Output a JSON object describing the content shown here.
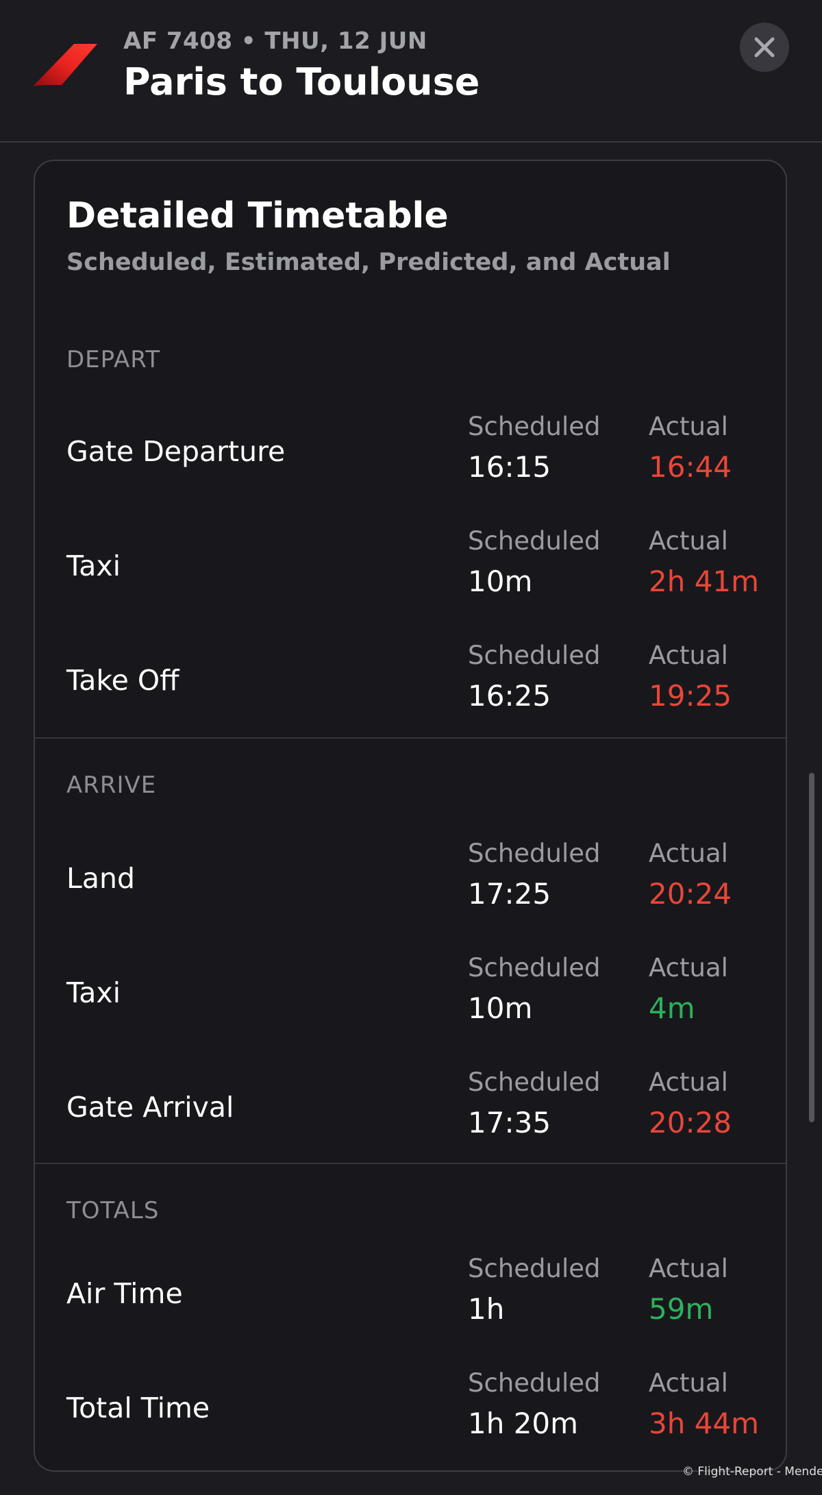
{
  "header": {
    "flight_meta": "AF 7408 • THU, 12 JUN",
    "route_title": "Paris to Toulouse",
    "logo_icon": "air-france-logo-icon",
    "close_icon": "close-icon",
    "accent_color": "#e8231f"
  },
  "card": {
    "title": "Detailed Timetable",
    "subtitle": "Scheduled, Estimated, Predicted, and Actual"
  },
  "sections": [
    {
      "label": "DEPART",
      "rows": [
        {
          "label": "Gate Departure",
          "scheduled_label": "Scheduled",
          "scheduled": "16:15",
          "actual_label": "Actual",
          "actual": "16:44",
          "actual_status": "late"
        },
        {
          "label": "Taxi",
          "scheduled_label": "Scheduled",
          "scheduled": "10m",
          "actual_label": "Actual",
          "actual": "2h 41m",
          "actual_status": "late"
        },
        {
          "label": "Take Off",
          "scheduled_label": "Scheduled",
          "scheduled": "16:25",
          "actual_label": "Actual",
          "actual": "19:25",
          "actual_status": "late"
        }
      ]
    },
    {
      "label": "ARRIVE",
      "rows": [
        {
          "label": "Land",
          "scheduled_label": "Scheduled",
          "scheduled": "17:25",
          "actual_label": "Actual",
          "actual": "20:24",
          "actual_status": "late"
        },
        {
          "label": "Taxi",
          "scheduled_label": "Scheduled",
          "scheduled": "10m",
          "actual_label": "Actual",
          "actual": "4m",
          "actual_status": "early"
        },
        {
          "label": "Gate Arrival",
          "scheduled_label": "Scheduled",
          "scheduled": "17:35",
          "actual_label": "Actual",
          "actual": "20:28",
          "actual_status": "late"
        }
      ]
    },
    {
      "label": "TOTALS",
      "rows": [
        {
          "label": "Air Time",
          "scheduled_label": "Scheduled",
          "scheduled": "1h",
          "actual_label": "Actual",
          "actual": "59m",
          "actual_status": "early"
        },
        {
          "label": "Total Time",
          "scheduled_label": "Scheduled",
          "scheduled": "1h 20m",
          "actual_label": "Actual",
          "actual": "3h 44m",
          "actual_status": "late"
        }
      ]
    }
  ],
  "status_colors": {
    "late": "#ea4638",
    "early": "#2db15c"
  },
  "credit": "© Flight-Report - Mendes"
}
